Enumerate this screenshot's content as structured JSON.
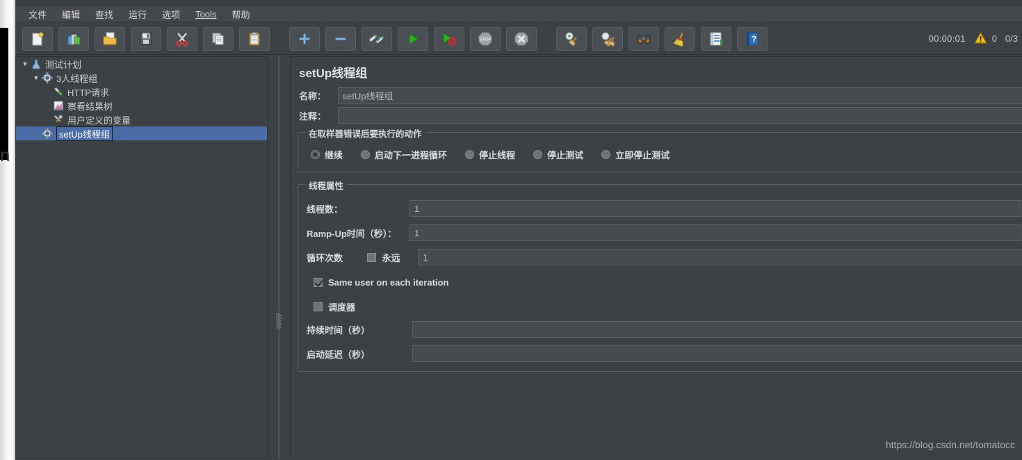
{
  "window": {
    "background_glyph": "n"
  },
  "menubar": {
    "items": [
      {
        "label": "文件",
        "underlined": false
      },
      {
        "label": "编辑",
        "underlined": false
      },
      {
        "label": "查找",
        "underlined": false
      },
      {
        "label": "运行",
        "underlined": false
      },
      {
        "label": "选项",
        "underlined": false
      },
      {
        "label": "Tools",
        "underlined": true
      },
      {
        "label": "帮助",
        "underlined": false
      }
    ]
  },
  "toolbar": {
    "buttons": [
      {
        "name": "new-test-plan-button",
        "icon": "new-document-icon",
        "title": "新建"
      },
      {
        "name": "templates-button",
        "icon": "templates-icon",
        "title": "模板"
      },
      {
        "name": "open-button",
        "icon": "open-folder-icon",
        "title": "打开"
      },
      {
        "name": "save-button",
        "icon": "save-disk-icon",
        "title": "保存"
      },
      {
        "name": "cut-button",
        "icon": "scissors-icon",
        "title": "剪切"
      },
      {
        "name": "copy-button",
        "icon": "copy-icon",
        "title": "复制"
      },
      {
        "name": "paste-button",
        "icon": "clipboard-paste-icon",
        "title": "粘贴"
      },
      {
        "name": "expand-all-button",
        "icon": "plus-icon",
        "title": "展开"
      },
      {
        "name": "collapse-all-button",
        "icon": "minus-icon",
        "title": "折叠"
      },
      {
        "name": "toggle-button",
        "icon": "toggle-pencil-icon",
        "title": "切换"
      },
      {
        "name": "start-button",
        "icon": "play-icon",
        "title": "启动"
      },
      {
        "name": "start-no-pauses-button",
        "icon": "play-no-pause-icon",
        "title": "无间隔启动"
      },
      {
        "name": "stop-button",
        "icon": "stop-octagon-icon",
        "title": "停止"
      },
      {
        "name": "shutdown-button",
        "icon": "shutdown-x-icon",
        "title": "关闭"
      },
      {
        "name": "clear-button",
        "icon": "clear-broom-icon",
        "title": "清除"
      },
      {
        "name": "clear-all-button",
        "icon": "clear-all-broom-icon",
        "title": "清除全部"
      },
      {
        "name": "search-button",
        "icon": "binoculars-icon",
        "title": "搜索"
      },
      {
        "name": "reset-search-button",
        "icon": "broom-icon",
        "title": "重置搜索"
      },
      {
        "name": "function-helper-button",
        "icon": "function-helper-icon",
        "title": "函数助手"
      },
      {
        "name": "help-button",
        "icon": "help-book-icon",
        "title": "帮助"
      }
    ],
    "status": {
      "timer": "00:00:01",
      "warning_icon": "warning-triangle-icon",
      "warning_count": "0",
      "thread_count": "0/3"
    }
  },
  "tree": {
    "nodes": [
      {
        "label": "测试计划",
        "icon": "flask-icon",
        "indent": 0,
        "twisty": "▼",
        "selected": false
      },
      {
        "label": "3人线程组",
        "icon": "gear-icon",
        "indent": 1,
        "twisty": "▼",
        "selected": false
      },
      {
        "label": "HTTP请求",
        "icon": "pipette-icon",
        "indent": 2,
        "twisty": "",
        "selected": false
      },
      {
        "label": "察看结果树",
        "icon": "chart-icon",
        "indent": 2,
        "twisty": "",
        "selected": false
      },
      {
        "label": "用户定义的变量",
        "icon": "tools-icon",
        "indent": 2,
        "twisty": "",
        "selected": false
      },
      {
        "label": "setUp线程组",
        "icon": "gear-icon",
        "indent": 1,
        "twisty": "",
        "selected": true
      }
    ]
  },
  "editor": {
    "title": "setUp线程组",
    "name_label": "名称：",
    "name_value": "setUp线程组",
    "comment_label": "注释：",
    "comment_value": "",
    "error_action": {
      "group_title": "在取样器错误后要执行的动作",
      "options": [
        {
          "label": "继续",
          "checked": true
        },
        {
          "label": "启动下一进程循环",
          "checked": false
        },
        {
          "label": "停止线程",
          "checked": false
        },
        {
          "label": "停止测试",
          "checked": false
        },
        {
          "label": "立即停止测试",
          "checked": false
        }
      ]
    },
    "thread_properties": {
      "group_title": "线程属性",
      "threads_label": "线程数：",
      "threads_value": "1",
      "rampup_label": "Ramp-Up时间（秒）：",
      "rampup_value": "1",
      "loops_label": "循环次数",
      "forever_label": "永远",
      "forever_checked": false,
      "loops_value": "1",
      "same_user_label": "Same user on each iteration",
      "same_user_checked": true,
      "scheduler_label": "调度器",
      "scheduler_checked": false,
      "duration_label": "持续时间（秒）",
      "duration_value": "",
      "startup_delay_label": "启动延迟（秒）",
      "startup_delay_value": ""
    }
  },
  "watermark": "https://blog.csdn.net/tomatocc",
  "colors": {
    "panel_bg": "#3c4145",
    "menu_bg": "#45494d",
    "selection_blue": "#4a6da7",
    "input_bg": "#464b50",
    "text": "#dcdcdc",
    "accent_green": "#3fae2a",
    "accent_yellow": "#f2c218"
  }
}
